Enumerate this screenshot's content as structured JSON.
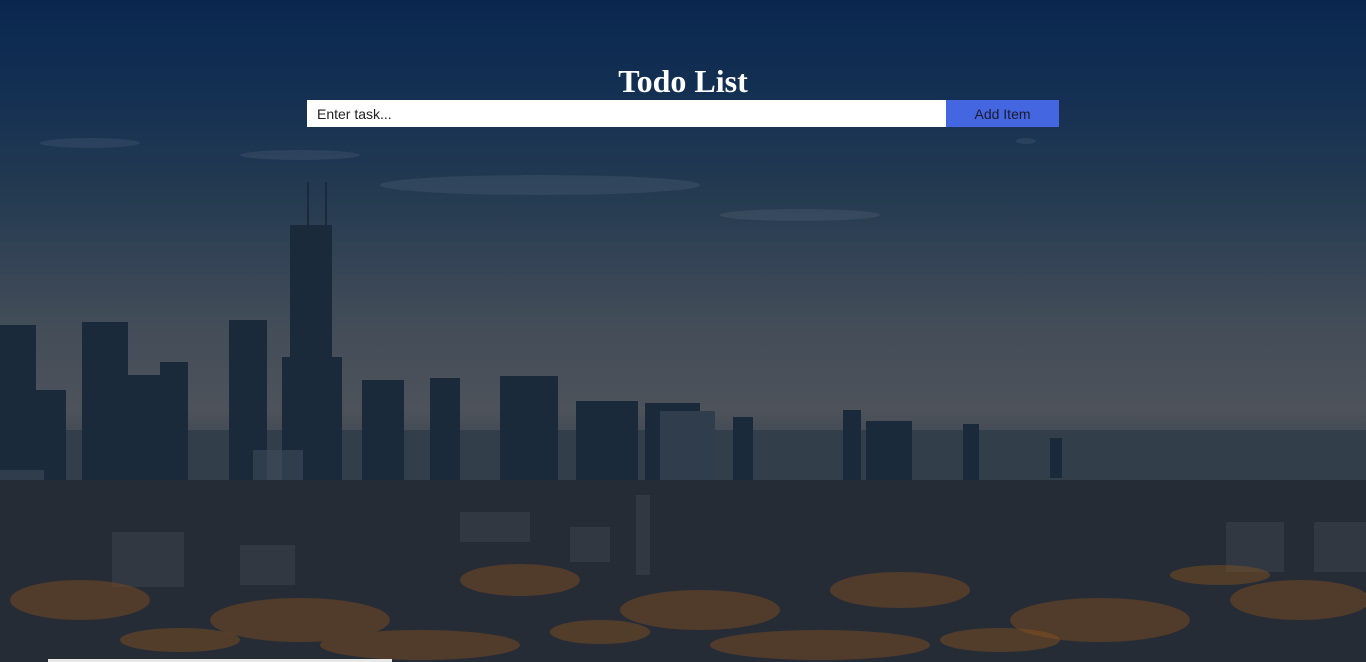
{
  "header": {
    "title": "Todo List"
  },
  "form": {
    "task_placeholder": "Enter task...",
    "task_value": "",
    "add_label": "Add Item"
  },
  "colors": {
    "accent": "#4466e0",
    "title_text": "#ffffff",
    "input_background": "#ffffff"
  }
}
